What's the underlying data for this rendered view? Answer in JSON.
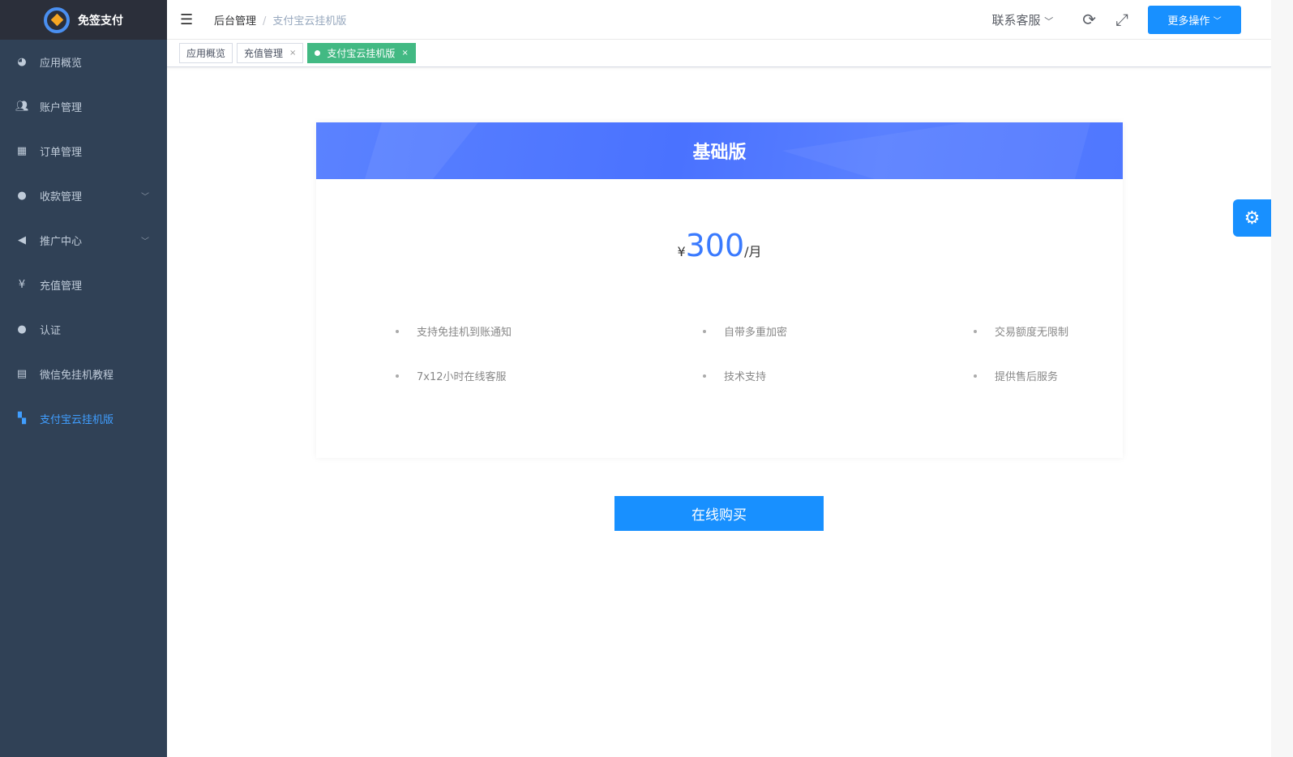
{
  "app": {
    "name": "免签支付"
  },
  "sidebar": {
    "items": [
      {
        "label": "应用概览",
        "icon": "dashboard-icon"
      },
      {
        "label": "账户管理",
        "icon": "users-icon"
      },
      {
        "label": "订单管理",
        "icon": "table-icon"
      },
      {
        "label": "收款管理",
        "icon": "wechat-icon",
        "expandable": true
      },
      {
        "label": "推广中心",
        "icon": "megaphone-icon",
        "expandable": true
      },
      {
        "label": "充值管理",
        "icon": "yen-icon"
      },
      {
        "label": "认证",
        "icon": "user-icon"
      },
      {
        "label": "微信免挂机教程",
        "icon": "document-icon"
      },
      {
        "label": "支付宝云挂机版",
        "icon": "grid-icon",
        "active": true
      }
    ]
  },
  "header": {
    "breadcrumb": [
      "后台管理",
      "支付宝云挂机版"
    ],
    "separator": "/",
    "contact": "联系客服",
    "more": "更多操作"
  },
  "tags": [
    {
      "label": "应用概览"
    },
    {
      "label": "充值管理",
      "close": "×"
    },
    {
      "label": "支付宝云挂机版",
      "close": "×",
      "active": true
    }
  ],
  "plan": {
    "title": "基础版",
    "currency": "¥",
    "price": "300",
    "unit": "/月",
    "features": [
      "支持免挂机到账通知",
      "自带多重加密",
      "交易额度无限制",
      "7x12小时在线客服",
      "技术支持",
      "提供售后服务"
    ]
  },
  "buy_label": "在线购买",
  "colors": {
    "sidebar": "#304156",
    "accent": "#1890ff",
    "tag_active": "#42b983",
    "price": "#3a7afe"
  }
}
